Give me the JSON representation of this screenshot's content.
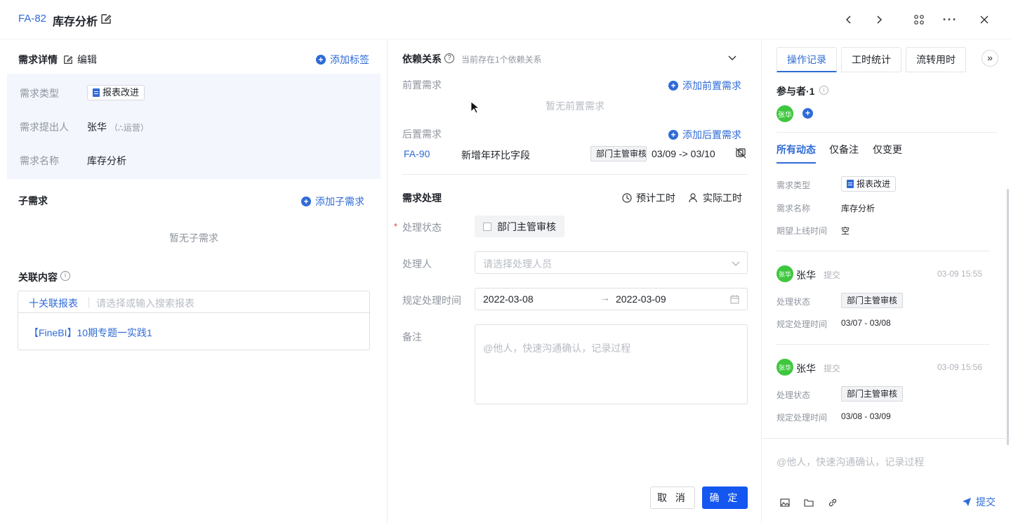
{
  "header": {
    "id": "FA-82",
    "title": "库存分析"
  },
  "left": {
    "details_title": "需求详情",
    "edit_label": "编辑",
    "add_tag": "添加标签",
    "fields": [
      {
        "label": "需求类型",
        "value": "报表改进"
      },
      {
        "label": "需求提出人",
        "value": "张华",
        "dept": "运营"
      },
      {
        "label": "需求名称",
        "value": "库存分析"
      }
    ],
    "sub_title": "子需求",
    "add_sub": "添加子需求",
    "no_sub": "暂无子需求",
    "related_title": "关联内容",
    "link_report": "十关联报表",
    "search_placeholder": "请选择或输入搜索报表",
    "related_item": "【FineBI】10期专题一实践1"
  },
  "middle": {
    "dep_title": "依赖关系",
    "dep_hint": "当前存在1个依赖关系",
    "pre_label": "前置需求",
    "add_pre": "添加前置需求",
    "no_pre": "暂无前置需求",
    "post_label": "后置需求",
    "add_post": "添加后置需求",
    "post_item": {
      "id": "FA-90",
      "name": "新增年环比字段",
      "status": "部门主管审核",
      "dates": "03/09 -> 03/10"
    },
    "handle_title": "需求处理",
    "est_time": "预计工时",
    "act_time": "实际工时",
    "status_label": "处理状态",
    "status_value": "部门主管审核",
    "handler_label": "处理人",
    "handler_placeholder": "请选择处理人员",
    "time_label": "规定处理时间",
    "start_date": "2022-03-08",
    "end_date": "2022-03-09",
    "note_label": "备注",
    "note_placeholder": "@他人，快速沟通确认，记录过程",
    "cancel": "取 消",
    "confirm": "确 定"
  },
  "right": {
    "tabs": [
      "操作记录",
      "工时统计",
      "流转用时"
    ],
    "participants": "参与者·1",
    "participant_avatar": "张华",
    "filters": [
      "所有动态",
      "仅备注",
      "仅变更"
    ],
    "first_entry": [
      {
        "label": "需求类型",
        "value": "报表改进"
      },
      {
        "label": "需求名称",
        "value": "库存分析"
      },
      {
        "label": "期望上线时间",
        "value": "空"
      }
    ],
    "entries": [
      {
        "avatar": "张华",
        "user": "张华",
        "action": "提交",
        "time": "03-09 15:55",
        "status_label": "处理状态",
        "status": "部门主管审核",
        "time_label": "规定处理时间",
        "range": "03/07 - 03/08"
      },
      {
        "avatar": "张华",
        "user": "张华",
        "action": "提交",
        "time": "03-09 15:56",
        "status_label": "处理状态",
        "status": "部门主管审核",
        "time_label": "规定处理时间",
        "range": "03/08 - 03/09"
      }
    ],
    "comment_placeholder": "@他人，快速沟通确认，记录过程",
    "submit": "提交"
  }
}
